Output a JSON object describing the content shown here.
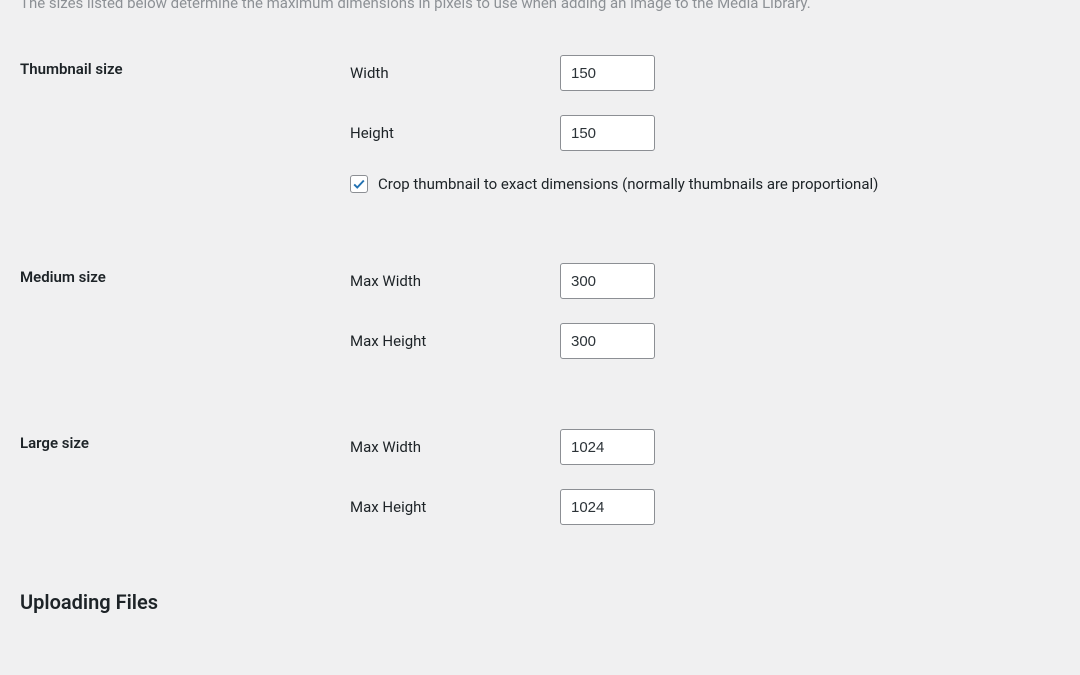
{
  "intro_text": "The sizes listed below determine the maximum dimensions in pixels to use when adding an image to the Media Library.",
  "thumbnail": {
    "section_label": "Thumbnail size",
    "width_label": "Width",
    "width_value": "150",
    "height_label": "Height",
    "height_value": "150",
    "crop_checked": true,
    "crop_label": "Crop thumbnail to exact dimensions (normally thumbnails are proportional)"
  },
  "medium": {
    "section_label": "Medium size",
    "max_width_label": "Max Width",
    "max_width_value": "300",
    "max_height_label": "Max Height",
    "max_height_value": "300"
  },
  "large": {
    "section_label": "Large size",
    "max_width_label": "Max Width",
    "max_width_value": "1024",
    "max_height_label": "Max Height",
    "max_height_value": "1024"
  },
  "uploading_heading": "Uploading Files"
}
